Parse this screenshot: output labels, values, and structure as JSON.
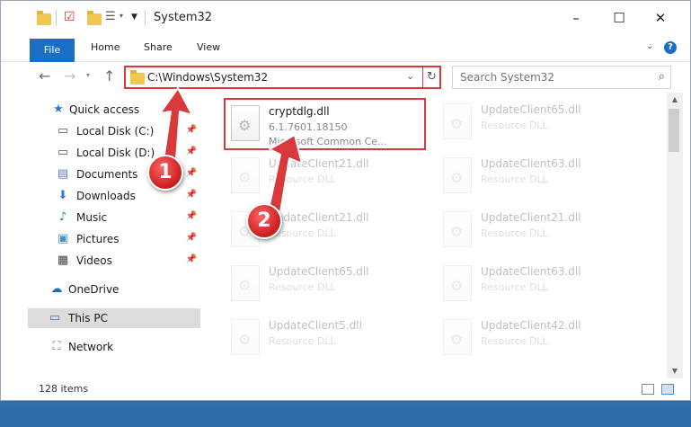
{
  "window": {
    "title": "System32",
    "tabs": {
      "file": "File",
      "home": "Home",
      "share": "Share",
      "view": "View"
    }
  },
  "address": {
    "path": "C:\\Windows\\System32",
    "search_placeholder": "Search System32"
  },
  "sidebar": {
    "items": [
      {
        "label": "Quick access",
        "icon": "star-icon",
        "pinned": false
      },
      {
        "label": "Local Disk (C:)",
        "icon": "drive-icon",
        "pinned": true
      },
      {
        "label": "Local Disk (D:)",
        "icon": "drive-icon",
        "pinned": true
      },
      {
        "label": "Documents",
        "icon": "documents-icon",
        "pinned": true
      },
      {
        "label": "Downloads",
        "icon": "downloads-icon",
        "pinned": true
      },
      {
        "label": "Music",
        "icon": "music-icon",
        "pinned": true
      },
      {
        "label": "Pictures",
        "icon": "pictures-icon",
        "pinned": true
      },
      {
        "label": "Videos",
        "icon": "videos-icon",
        "pinned": true
      },
      {
        "label": "OneDrive",
        "icon": "onedrive-icon",
        "pinned": false
      },
      {
        "label": "This PC",
        "icon": "this-pc-icon",
        "pinned": false
      },
      {
        "label": "Network",
        "icon": "network-icon",
        "pinned": false
      }
    ]
  },
  "files": [
    {
      "name": "cryptdlg.dll",
      "line1": "6.1.7601.18150",
      "line2": "Microsoft Common Ce..."
    },
    {
      "name": "UpdateClient65.dll",
      "line1": "Resource DLL"
    },
    {
      "name": "UpdateClient21.dll",
      "line1": "Resource DLL"
    },
    {
      "name": "UpdateClient63.dll",
      "line1": "Resource DLL"
    },
    {
      "name": "UpdateClient21.dll",
      "line1": "Resource DLL"
    },
    {
      "name": "UpdateClient21.dll",
      "line1": "Resource DLL"
    },
    {
      "name": "UpdateClient65.dll",
      "line1": "Resource DLL"
    },
    {
      "name": "UpdateClient63.dll",
      "line1": "Resource DLL"
    },
    {
      "name": "UpdateClient5.dll",
      "line1": "Resource DLL"
    },
    {
      "name": "UpdateClient42.dll",
      "line1": "Resource DLL"
    }
  ],
  "status": {
    "item_count": "128 items"
  },
  "callouts": {
    "one": "1",
    "two": "2"
  },
  "colors": {
    "highlight": "#d9393a",
    "accent": "#1a6ec8",
    "selected": "#dcdcdc"
  }
}
